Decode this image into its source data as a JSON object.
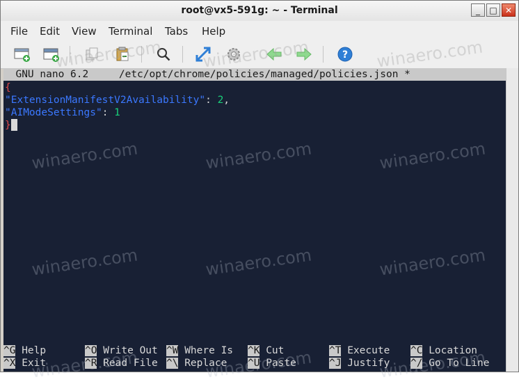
{
  "window": {
    "title": "root@vx5-591g: ~ - Terminal",
    "buttons": [
      "_",
      "□",
      "✕"
    ]
  },
  "menubar": {
    "items": [
      "File",
      "Edit",
      "View",
      "Terminal",
      "Tabs",
      "Help"
    ]
  },
  "toolbar": {
    "icons": [
      "new-tab-icon",
      "new-window-icon",
      "copy-icon",
      "paste-icon",
      "search-icon",
      "fullscreen-icon",
      "preferences-icon",
      "previous-tab-icon",
      "next-tab-icon",
      "help-icon"
    ]
  },
  "editor": {
    "status": "  GNU nano 6.2     /etc/opt/chrome/policies/managed/policies.json *",
    "lines": [
      {
        "segments": [
          {
            "text": "{",
            "cls": "r"
          }
        ]
      },
      {
        "segments": [
          {
            "text": "\"ExtensionManifestV2Availability\"",
            "cls": "k"
          },
          {
            "text": ": ",
            "cls": "p"
          },
          {
            "text": "2",
            "cls": "n"
          },
          {
            "text": ",",
            "cls": "p"
          }
        ]
      },
      {
        "segments": [
          {
            "text": "\"AIModeSettings\"",
            "cls": "k"
          },
          {
            "text": ": ",
            "cls": "p"
          },
          {
            "text": "1",
            "cls": "n"
          }
        ]
      },
      {
        "segments": [
          {
            "text": "}",
            "cls": "r"
          }
        ]
      }
    ]
  },
  "shortcuts": [
    {
      "key": "^G",
      "label": "Help"
    },
    {
      "key": "^O",
      "label": "Write Out"
    },
    {
      "key": "^W",
      "label": "Where Is"
    },
    {
      "key": "^K",
      "label": "Cut"
    },
    {
      "key": "^T",
      "label": "Execute"
    },
    {
      "key": "^C",
      "label": "Location"
    },
    {
      "key": "^X",
      "label": "Exit"
    },
    {
      "key": "^R",
      "label": "Read File"
    },
    {
      "key": "^\\",
      "label": "Replace"
    },
    {
      "key": "^U",
      "label": "Paste"
    },
    {
      "key": "^J",
      "label": "Justify"
    },
    {
      "key": "^/",
      "label": "Go To Line"
    }
  ],
  "watermark": {
    "text": "winaero.com"
  }
}
